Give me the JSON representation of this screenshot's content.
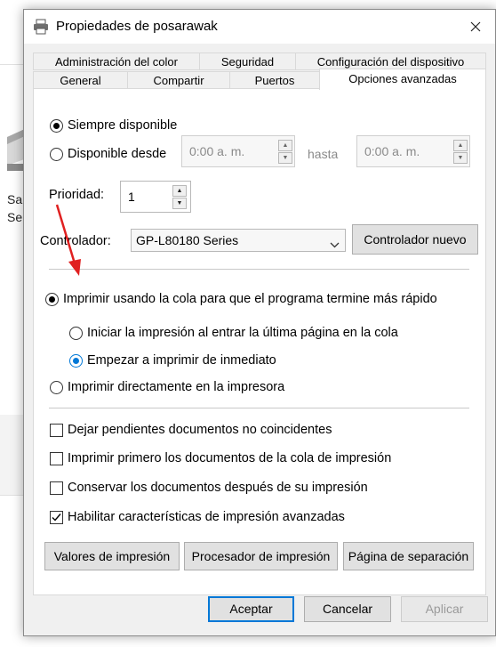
{
  "window": {
    "title": "Propiedades de posarawak"
  },
  "background": {
    "text1": "Sa",
    "text2": "Se"
  },
  "tabs": {
    "row1": [
      "Administración del color",
      "Seguridad",
      "Configuración del dispositivo"
    ],
    "row2": [
      "General",
      "Compartir",
      "Puertos",
      "Opciones avanzadas"
    ],
    "active": "Opciones avanzadas"
  },
  "availability": {
    "always": "Siempre disponible",
    "from": "Disponible desde",
    "from_time": "0:00 a. m.",
    "until_label": "hasta",
    "until_time": "0:00 a. m."
  },
  "priority": {
    "label": "Prioridad:",
    "value": "1"
  },
  "driver": {
    "label": "Controlador:",
    "selected": "GP-L80180 Series",
    "new_button": "Controlador nuevo"
  },
  "spool": {
    "use_spool": "Imprimir usando la cola para que el programa termine más rápido",
    "start_last_page": "Iniciar la impresión al entrar la última página en la cola",
    "start_immediately": "Empezar a imprimir de inmediato",
    "print_direct": "Imprimir directamente en la impresora"
  },
  "options": [
    {
      "label": "Dejar pendientes documentos no coincidentes",
      "checked": false
    },
    {
      "label": "Imprimir primero los documentos de la cola de impresión",
      "checked": false
    },
    {
      "label": "Conservar los documentos después de su impresión",
      "checked": false
    },
    {
      "label": "Habilitar características de impresión avanzadas",
      "checked": true
    }
  ],
  "panel_buttons": {
    "defaults": "Valores de impresión",
    "processor": "Procesador de impresión",
    "separator": "Página de separación"
  },
  "footer": {
    "ok": "Aceptar",
    "cancel": "Cancelar",
    "apply": "Aplicar"
  },
  "colors": {
    "accent": "#0078d7",
    "annotation_arrow": "#e02020"
  }
}
